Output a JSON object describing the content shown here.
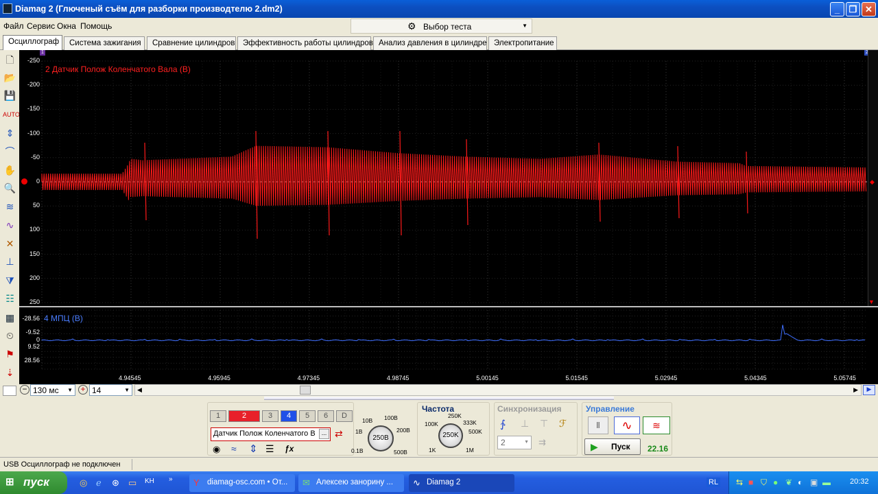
{
  "window": {
    "title": "Diamag 2 (Глюченый съём для разборки производтелю 2.dm2)"
  },
  "menu": [
    "Файл",
    "Сервис",
    "Окна",
    "Помощь"
  ],
  "test_selector": {
    "label": "Выбор теста"
  },
  "tabs": [
    "Осциллограф",
    "Система зажигания",
    "Сравнение цилиндров",
    "Эффективность работы цилиндров",
    "Анализ давления в цилиндре",
    "Электропитание"
  ],
  "channel1": {
    "name": "2 Датчик Полож Коленчатого Вала (В)",
    "color": "#ff1a1a",
    "y_ticks": [
      "-250",
      "-200",
      "-150",
      "-100",
      "-50",
      "0",
      "50",
      "100",
      "150",
      "200",
      "250"
    ],
    "marker_top": "1",
    "marker_right": "2"
  },
  "channel2": {
    "name": "4 МПЦ (В)",
    "color": "#3f6fff",
    "y_ticks": [
      "-28.56",
      "-9.52",
      "0",
      "9.52",
      "28.56"
    ]
  },
  "x_ticks": [
    "4.94545",
    "4.95945",
    "4.97345",
    "4.98745",
    "5.00145",
    "5.01545",
    "5.02945",
    "5.04345",
    "5.05745"
  ],
  "timebase": {
    "value": "130 мс",
    "zoom": "14"
  },
  "channels": [
    {
      "label": "1",
      "state": "off"
    },
    {
      "label": "2",
      "state": "red"
    },
    {
      "label": "3",
      "state": "off"
    },
    {
      "label": "4",
      "state": "blue"
    },
    {
      "label": "5",
      "state": "off"
    },
    {
      "label": "6",
      "state": "off"
    },
    {
      "label": "D",
      "state": "off"
    }
  ],
  "sensor_field": "Датчик Полож Коленчатого В",
  "sensor_more": "...",
  "voltage": {
    "value": "250В",
    "labels": [
      "10В",
      "100В",
      "1В",
      "200В",
      "0.1В",
      "500В"
    ]
  },
  "frequency": {
    "title": "Частота",
    "value": "250K",
    "labels": [
      "250K",
      "100K",
      "333K",
      "500K",
      "1K",
      "1M"
    ]
  },
  "sync": {
    "title": "Синхронизация",
    "channel": "2"
  },
  "control": {
    "title": "Управление",
    "start": "Пуск",
    "counter": "22.16"
  },
  "status": {
    "text": "USB Осциллограф не подключен"
  },
  "taskbar": {
    "start": "пуск",
    "tasks": [
      "diamag-osc.com • От...",
      "Алексею занорину ...",
      "Diamag 2"
    ],
    "lang": "RL",
    "clock": "20:32"
  }
}
